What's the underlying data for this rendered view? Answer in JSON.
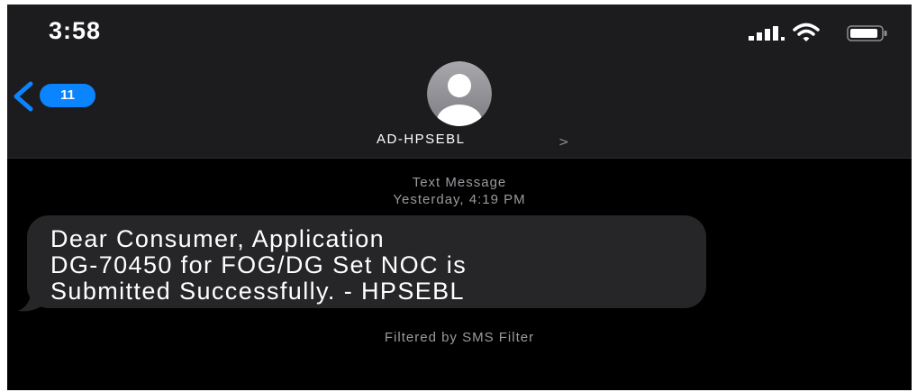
{
  "status_bar": {
    "time": "3:58",
    "icons": [
      "signal-icon",
      "wifi-icon",
      "battery-icon"
    ]
  },
  "nav": {
    "back_badge_count": "11",
    "contact_name": "AD-HPSEBL",
    "contact_chevron": ">"
  },
  "thread": {
    "message_type": "Text Message",
    "timestamp": "Yesterday, 4:19 PM",
    "messages": [
      {
        "direction": "incoming",
        "text": "Dear Consumer, Application\nDG-70450 for FOG/DG Set NOC is\nSubmitted Successfully. - HPSEBL"
      }
    ],
    "filter_note": "Filtered by SMS Filter"
  },
  "colors": {
    "background": "#000000",
    "header": "#1c1c1e",
    "bubble": "#262628",
    "accent": "#0a84ff",
    "secondary_text": "#9a9a9f"
  }
}
